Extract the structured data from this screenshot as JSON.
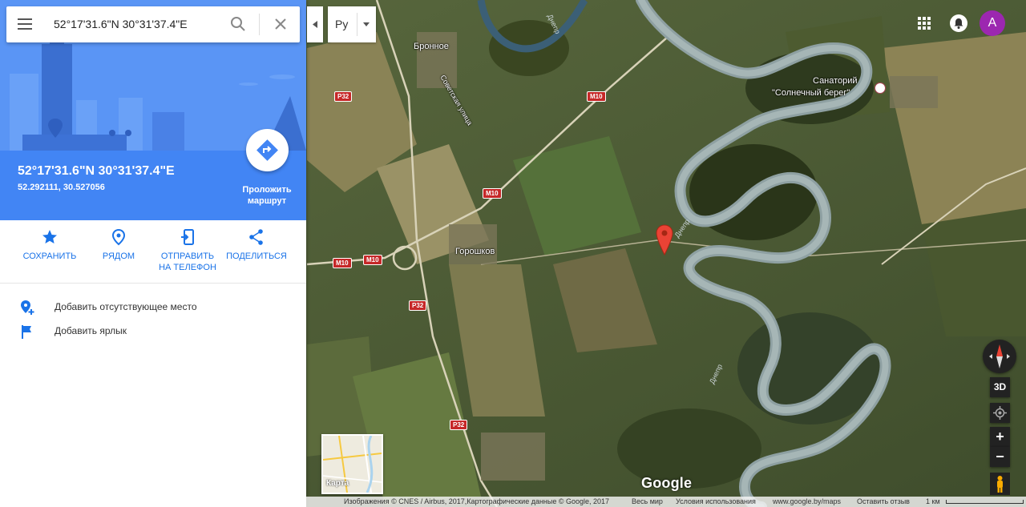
{
  "search": {
    "value": "52°17'31.6\"N 30°31'37.4\"E"
  },
  "place": {
    "title": "52°17'31.6\"N 30°31'37.4\"E",
    "decimal": "52.292111, 30.527056",
    "route_label_line1": "Проложить",
    "route_label_line2": "маршрут"
  },
  "actions": [
    {
      "label_line1": "СОХРАНИТЬ",
      "label_line2": "",
      "icon": "star-icon"
    },
    {
      "label_line1": "РЯДОМ",
      "label_line2": "",
      "icon": "nearby-icon"
    },
    {
      "label_line1": "ОТПРАВИТЬ",
      "label_line2": "НА ТЕЛЕФОН",
      "icon": "send-to-phone-icon"
    },
    {
      "label_line1": "ПОДЕЛИТЬСЯ",
      "label_line2": "",
      "icon": "share-icon"
    }
  ],
  "rows": [
    {
      "label": "Добавить отсутствующее место",
      "icon": "add-place-icon"
    },
    {
      "label": "Добавить ярлык",
      "icon": "flag-icon"
    }
  ],
  "language": {
    "selected": "Ру"
  },
  "user": {
    "initial": "A"
  },
  "controls": {
    "three_d": "3D",
    "zoom_in": "+",
    "zoom_out": "−"
  },
  "minimap": {
    "label": "Карта"
  },
  "branding": {
    "logo": "Google"
  },
  "map_labels": {
    "bronnoe": "Бронное",
    "sanatorium_line1": "Санаторий",
    "sanatorium_line2": "\"Солнечный берег\"",
    "goroshkov": "Горошков",
    "street": "Советская улица",
    "river": "Днепр"
  },
  "road_signs": {
    "m10": "M10",
    "p32": "P32"
  },
  "footer": {
    "attribution": "Изображения © CNES / Airbus, 2017,Картографические данные © Google, 2017",
    "world": "Весь мир",
    "terms": "Условия использования",
    "url": "www.google.by/maps",
    "feedback": "Оставить отзыв",
    "scale": "1 км"
  },
  "colors": {
    "accent": "#4285f4",
    "action_text": "#1a73e8",
    "pin": "#ea4335",
    "avatar": "#9c27b0"
  }
}
